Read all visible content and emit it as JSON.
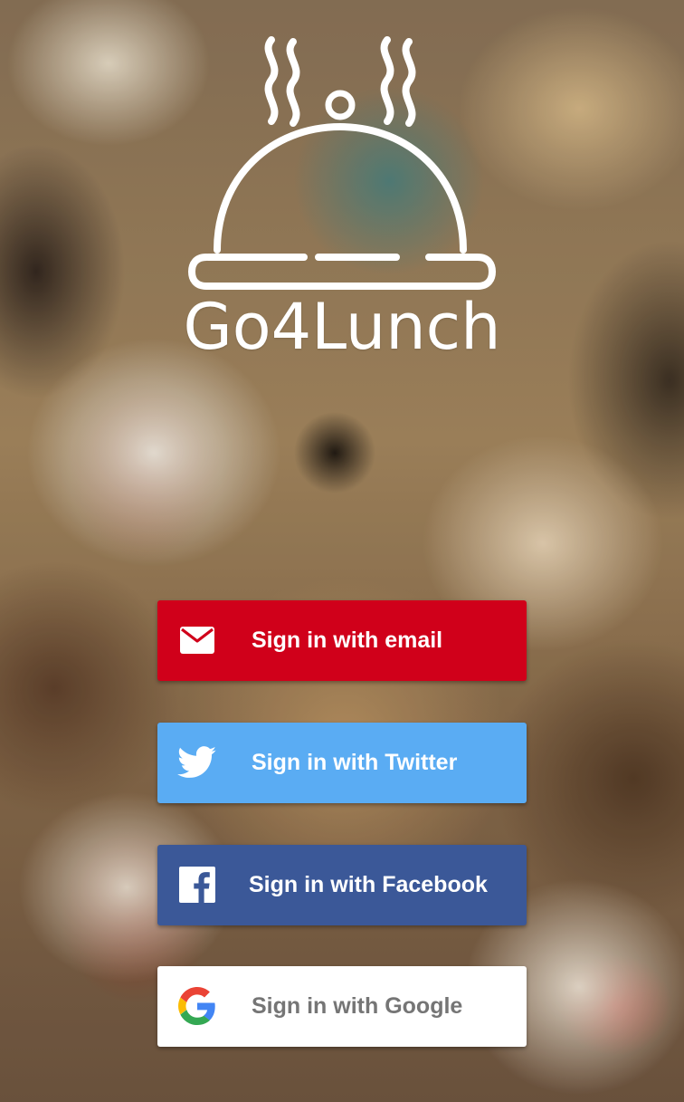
{
  "app": {
    "name": "Go4Lunch"
  },
  "auth_buttons": {
    "email": {
      "label": "Sign in with email",
      "icon": "mail-icon",
      "color": "#d0001a"
    },
    "twitter": {
      "label": "Sign in with Twitter",
      "icon": "twitter-icon",
      "color": "#5aacf3"
    },
    "facebook": {
      "label": "Sign in with Facebook",
      "icon": "facebook-icon",
      "color": "#3b5898"
    },
    "google": {
      "label": "Sign in with Google",
      "icon": "google-icon",
      "color": "#ffffff"
    }
  }
}
